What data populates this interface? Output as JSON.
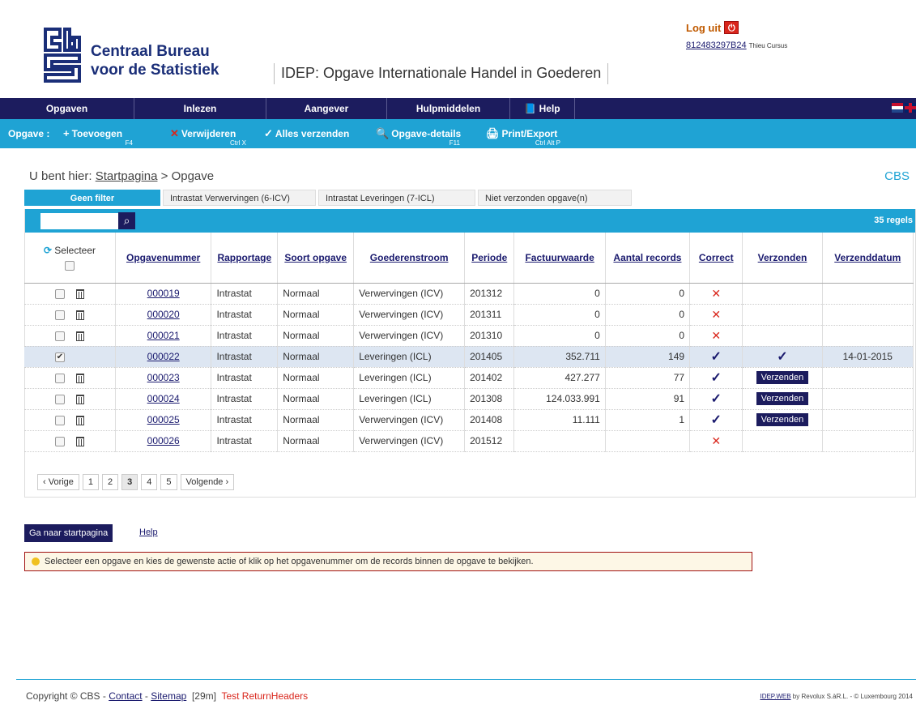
{
  "header": {
    "org_line1": "Centraal Bureau",
    "org_line2": "voor de Statistiek",
    "app_title": "IDEP: Opgave Internationale Handel in Goederen",
    "logout_label": "Log uit",
    "user_id": "812483297B24",
    "user_name": "Thieu Cursus"
  },
  "mainnav": [
    {
      "label": "Opgaven"
    },
    {
      "label": "Inlezen"
    },
    {
      "label": "Aangever"
    },
    {
      "label": "Hulpmiddelen"
    },
    {
      "label": "Help"
    }
  ],
  "toolbar": {
    "label": "Opgave :",
    "add": {
      "label": "Toevoegen",
      "shortcut": "F4"
    },
    "delete": {
      "label": "Verwijderen",
      "shortcut": "Ctrl X"
    },
    "send_all": {
      "label": "Alles verzenden"
    },
    "details": {
      "label": "Opgave-details",
      "shortcut": "F11"
    },
    "print": {
      "label": "Print/Export",
      "shortcut": "Ctrl Alt P"
    }
  },
  "breadcrumb": {
    "prefix": "U bent hier:",
    "home": "Startpagina",
    "separator": ">",
    "current": "Opgave"
  },
  "cbs_link": "CBS",
  "filters": [
    "Geen filter",
    "Intrastat Verwervingen (6-ICV)",
    "Intrastat Leveringen (7-ICL)",
    "Niet verzonden opgave(n)"
  ],
  "search": {
    "value": "",
    "placeholder": ""
  },
  "row_count": "35 regels",
  "table": {
    "select_label": "Selecteer",
    "headers": [
      "Opgavenummer",
      "Rapportage",
      "Soort opgave",
      "Goederenstroom",
      "Periode",
      "Factuurwaarde",
      "Aantal records",
      "Correct",
      "Verzonden",
      "Verzenddatum"
    ],
    "rows": [
      {
        "checked": false,
        "nr": "000019",
        "rapportage": "Intrastat",
        "soort": "Normaal",
        "stroom": "Verwervingen (ICV)",
        "periode": "201312",
        "factuur": "0",
        "aantal": "0",
        "correct": "x",
        "verzonden": "",
        "datum": ""
      },
      {
        "checked": false,
        "nr": "000020",
        "rapportage": "Intrastat",
        "soort": "Normaal",
        "stroom": "Verwervingen (ICV)",
        "periode": "201311",
        "factuur": "0",
        "aantal": "0",
        "correct": "x",
        "verzonden": "",
        "datum": ""
      },
      {
        "checked": false,
        "nr": "000021",
        "rapportage": "Intrastat",
        "soort": "Normaal",
        "stroom": "Verwervingen (ICV)",
        "periode": "201310",
        "factuur": "0",
        "aantal": "0",
        "correct": "x",
        "verzonden": "",
        "datum": ""
      },
      {
        "checked": true,
        "nr": "000022",
        "rapportage": "Intrastat",
        "soort": "Normaal",
        "stroom": "Leveringen (ICL)",
        "periode": "201405",
        "factuur": "352.711",
        "aantal": "149",
        "correct": "check",
        "verzonden": "check",
        "datum": "14-01-2015"
      },
      {
        "checked": false,
        "nr": "000023",
        "rapportage": "Intrastat",
        "soort": "Normaal",
        "stroom": "Leveringen (ICL)",
        "periode": "201402",
        "factuur": "427.277",
        "aantal": "77",
        "correct": "check",
        "verzonden": "button",
        "datum": ""
      },
      {
        "checked": false,
        "nr": "000024",
        "rapportage": "Intrastat",
        "soort": "Normaal",
        "stroom": "Leveringen (ICL)",
        "periode": "201308",
        "factuur": "124.033.991",
        "aantal": "91",
        "correct": "check",
        "verzonden": "button",
        "datum": ""
      },
      {
        "checked": false,
        "nr": "000025",
        "rapportage": "Intrastat",
        "soort": "Normaal",
        "stroom": "Verwervingen (ICV)",
        "periode": "201408",
        "factuur": "11.111",
        "aantal": "1",
        "correct": "check",
        "verzonden": "button",
        "datum": ""
      },
      {
        "checked": false,
        "nr": "000026",
        "rapportage": "Intrastat",
        "soort": "Normaal",
        "stroom": "Verwervingen (ICV)",
        "periode": "201512",
        "factuur": "",
        "aantal": "",
        "correct": "x",
        "verzonden": "",
        "datum": ""
      }
    ],
    "send_label": "Verzenden"
  },
  "pager": {
    "prev": "‹ Vorige",
    "pages": [
      "1",
      "2",
      "3",
      "4",
      "5"
    ],
    "current": "3",
    "next": "Volgende ›"
  },
  "actions": {
    "home_button": "Ga naar startpagina",
    "help_link": "Help"
  },
  "hint": "Selecteer een opgave en kies de gewenste actie of klik op het opgavenummer om de records binnen de opgave te bekijken.",
  "footer": {
    "copyright": "Copyright © CBS -",
    "contact": "Contact",
    "dash": "-",
    "sitemap": "Sitemap",
    "timer": "[29m]",
    "test": "Test ReturnHeaders",
    "right_link": "IDEP.WEB",
    "right_text": "by Revolux S.àR.L. - © Luxembourg 2014"
  },
  "colors": {
    "navy": "#1c1c5e",
    "accent": "#1fa3d4",
    "error": "#d9261c"
  }
}
